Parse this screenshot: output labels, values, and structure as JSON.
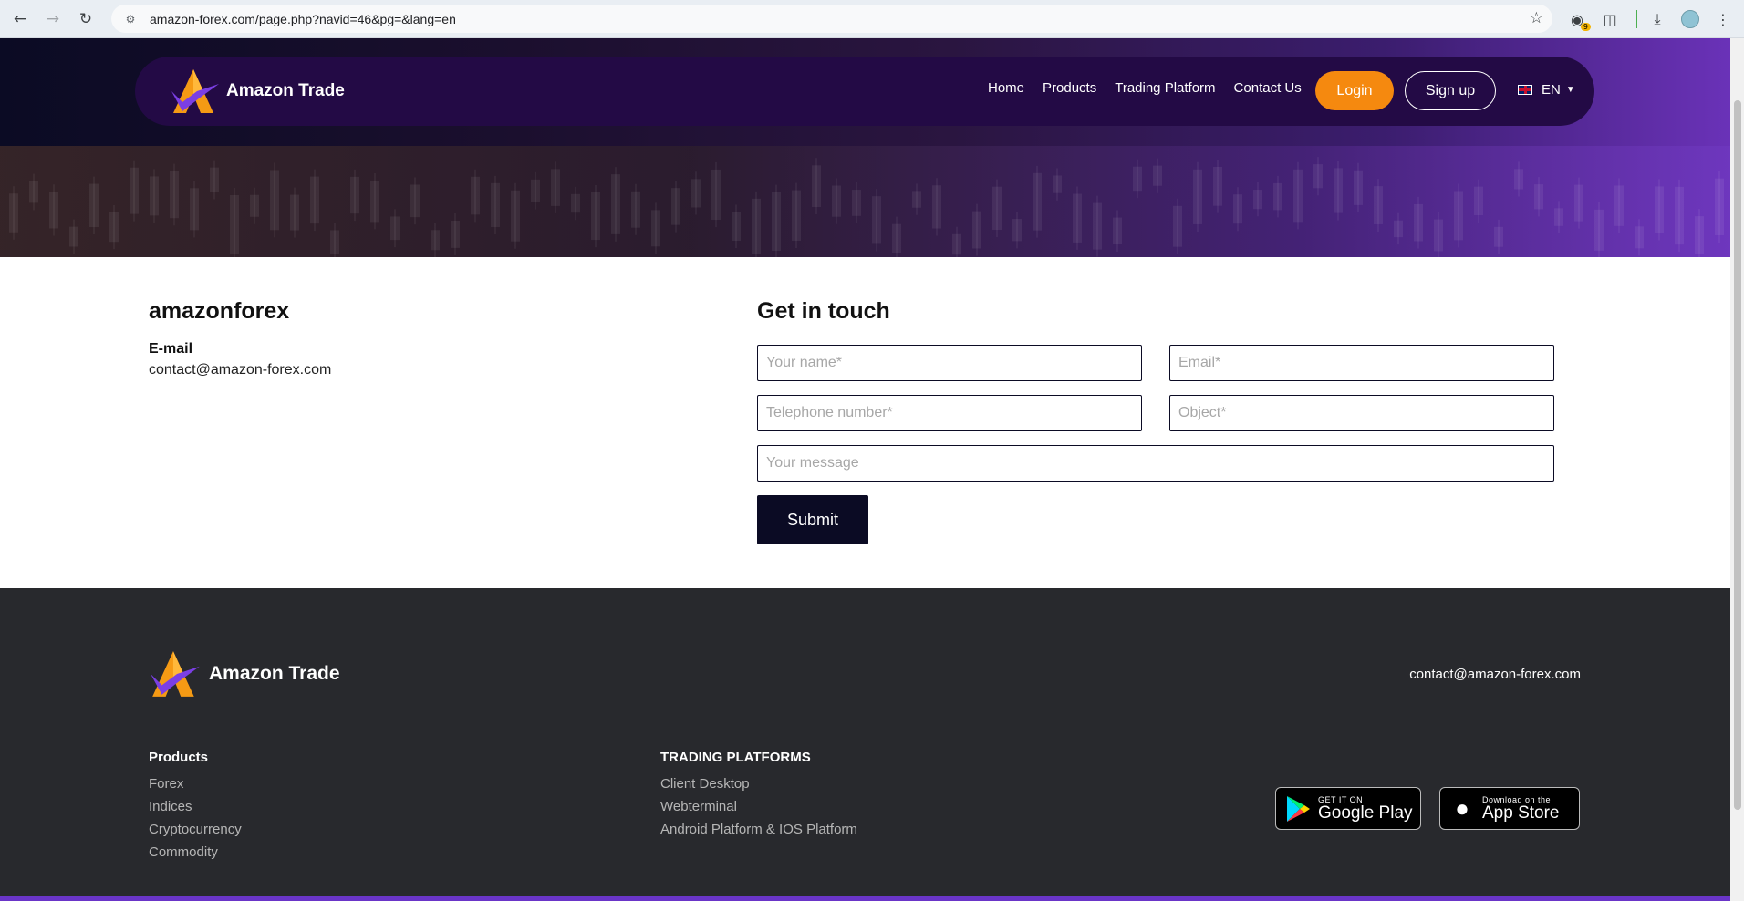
{
  "browser": {
    "url": "amazon-forex.com/page.php?navid=46&pg=&lang=en",
    "extension_badge": "9"
  },
  "nav": {
    "brand": "Amazon Trade",
    "menu": [
      "Home",
      "Products",
      "Trading Platform",
      "Contact Us"
    ],
    "login": "Login",
    "signup": "Sign up",
    "lang": "EN"
  },
  "contact": {
    "company": "amazonforex",
    "email_label": "E-mail",
    "email": "contact@amazon-forex.com"
  },
  "form": {
    "title": "Get in touch",
    "name_placeholder": "Your name*",
    "email_placeholder": "Email*",
    "phone_placeholder": "Telephone number*",
    "object_placeholder": "Object*",
    "message_placeholder": "Your message",
    "submit": "Submit"
  },
  "footer": {
    "brand": "Amazon Trade",
    "email": "contact@amazon-forex.com",
    "products_heading": "Products",
    "products": [
      "Forex",
      "Indices",
      "Cryptocurrency",
      "Commodity"
    ],
    "platforms_heading": "TRADING PLATFORMS",
    "platforms": [
      "Client Desktop",
      "Webterminal",
      "Android Platform & IOS Platform"
    ],
    "google_play_small": "GET IT ON",
    "google_play_big": "Google Play",
    "app_store_small": "Download on the",
    "app_store_big": "App Store"
  },
  "colors": {
    "nav_bg": "#230a45",
    "accent_orange": "#f5890f",
    "dark_navy": "#0b0b24",
    "footer_bg": "#28292d",
    "purple": "#6a35c8"
  }
}
